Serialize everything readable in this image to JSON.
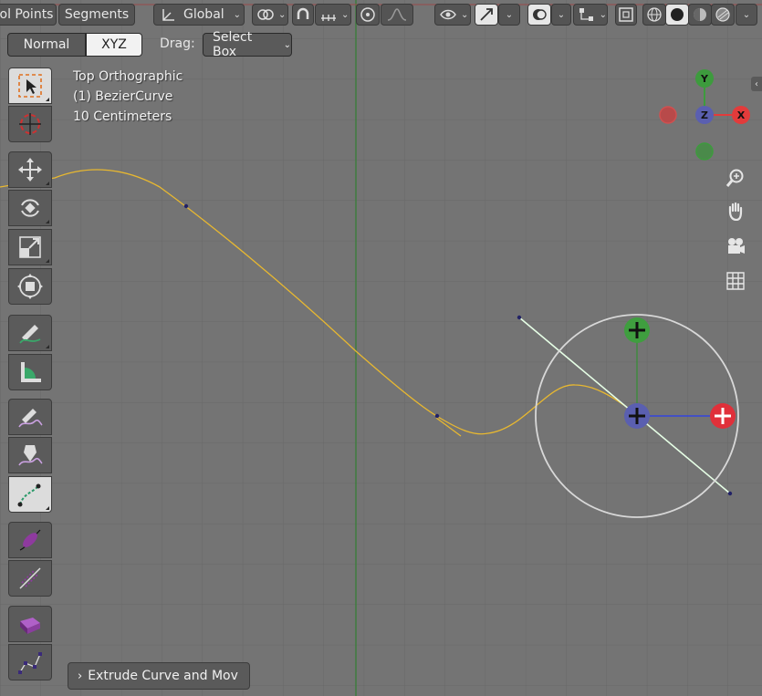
{
  "header": {
    "control_points_label": "ol Points",
    "segments_label": "Segments",
    "orientation_label": "Global",
    "chevron": "⌄"
  },
  "mode_row": {
    "normal_label": "Normal",
    "xyz_label": "XYZ",
    "drag_label": "Drag:",
    "drag_value": "Select Box"
  },
  "overlay": {
    "view_name": "Top Orthographic",
    "object_name": "(1) BezierCurve",
    "scale_text": "10 Centimeters"
  },
  "gizmo": {
    "x_label": "X",
    "y_label": "Y",
    "z_label": "Z",
    "x_color": "#e23b3b",
    "y_color": "#3d9b3d",
    "z_color": "#5a5fb0"
  },
  "last_operator": {
    "label": "Extrude Curve and Mov"
  },
  "colors": {
    "viewport_bg": "#747474",
    "curve": "#f0c030",
    "handle": "#e8ffe8",
    "accent_blue": "#4a72d0"
  },
  "icons": {
    "zoom": "zoom-icon",
    "pan": "hand-icon",
    "camera": "camera-icon",
    "grid": "grid-icon"
  }
}
